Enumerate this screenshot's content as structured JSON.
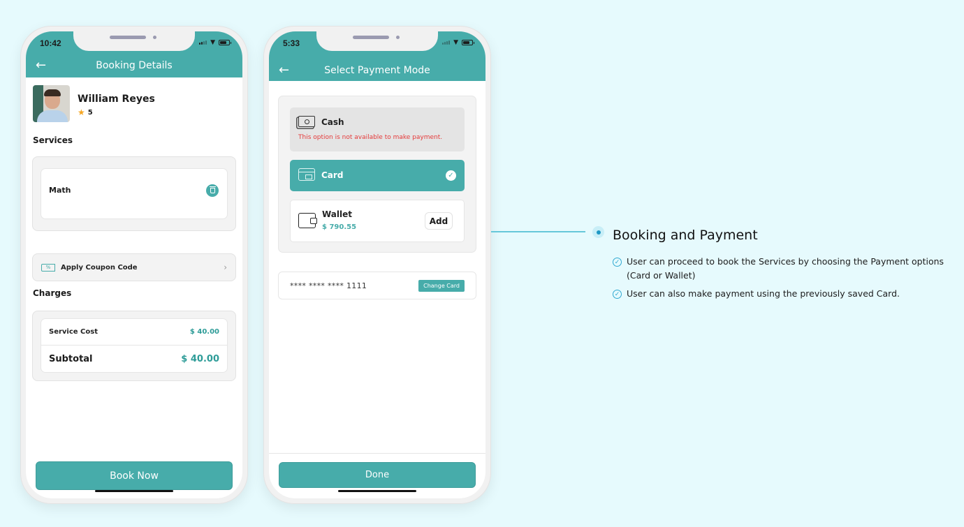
{
  "annotation": {
    "title": "Booking and Payment",
    "bullets": [
      "User can proceed to book the Services by choosing the Payment options (Card or Wallet)",
      "User can also make payment using the previously saved Card."
    ]
  },
  "booking_screen": {
    "status_time": "10:42",
    "header_title": "Booking Details",
    "provider": {
      "name": "William Reyes",
      "rating": "5"
    },
    "services_label": "Services",
    "services": [
      {
        "name": "Math"
      }
    ],
    "coupon_label": "Apply Coupon Code",
    "coupon_icon_text": "%",
    "charges_label": "Charges",
    "charges": {
      "service_cost_label": "Service Cost",
      "service_cost_value": "$ 40.00",
      "subtotal_label": "Subtotal",
      "subtotal_value": "$ 40.00"
    },
    "book_button": "Book Now"
  },
  "payment_screen": {
    "status_time": "5:33",
    "header_title": "Select Payment Mode",
    "options": {
      "cash": {
        "label": "Cash",
        "warning": "This option is not available to make payment.",
        "available": false
      },
      "card": {
        "label": "Card",
        "selected": true
      },
      "wallet": {
        "label": "Wallet",
        "balance": "$ 790.55",
        "add_button": "Add"
      }
    },
    "saved_card": {
      "masked_number": "**** **** **** 1111",
      "change_button": "Change Card"
    },
    "done_button": "Done"
  },
  "colors": {
    "brand": "#47acaa",
    "warning": "#e53a3a",
    "background": "#e6fafd",
    "accent_line": "#66c7d9"
  }
}
